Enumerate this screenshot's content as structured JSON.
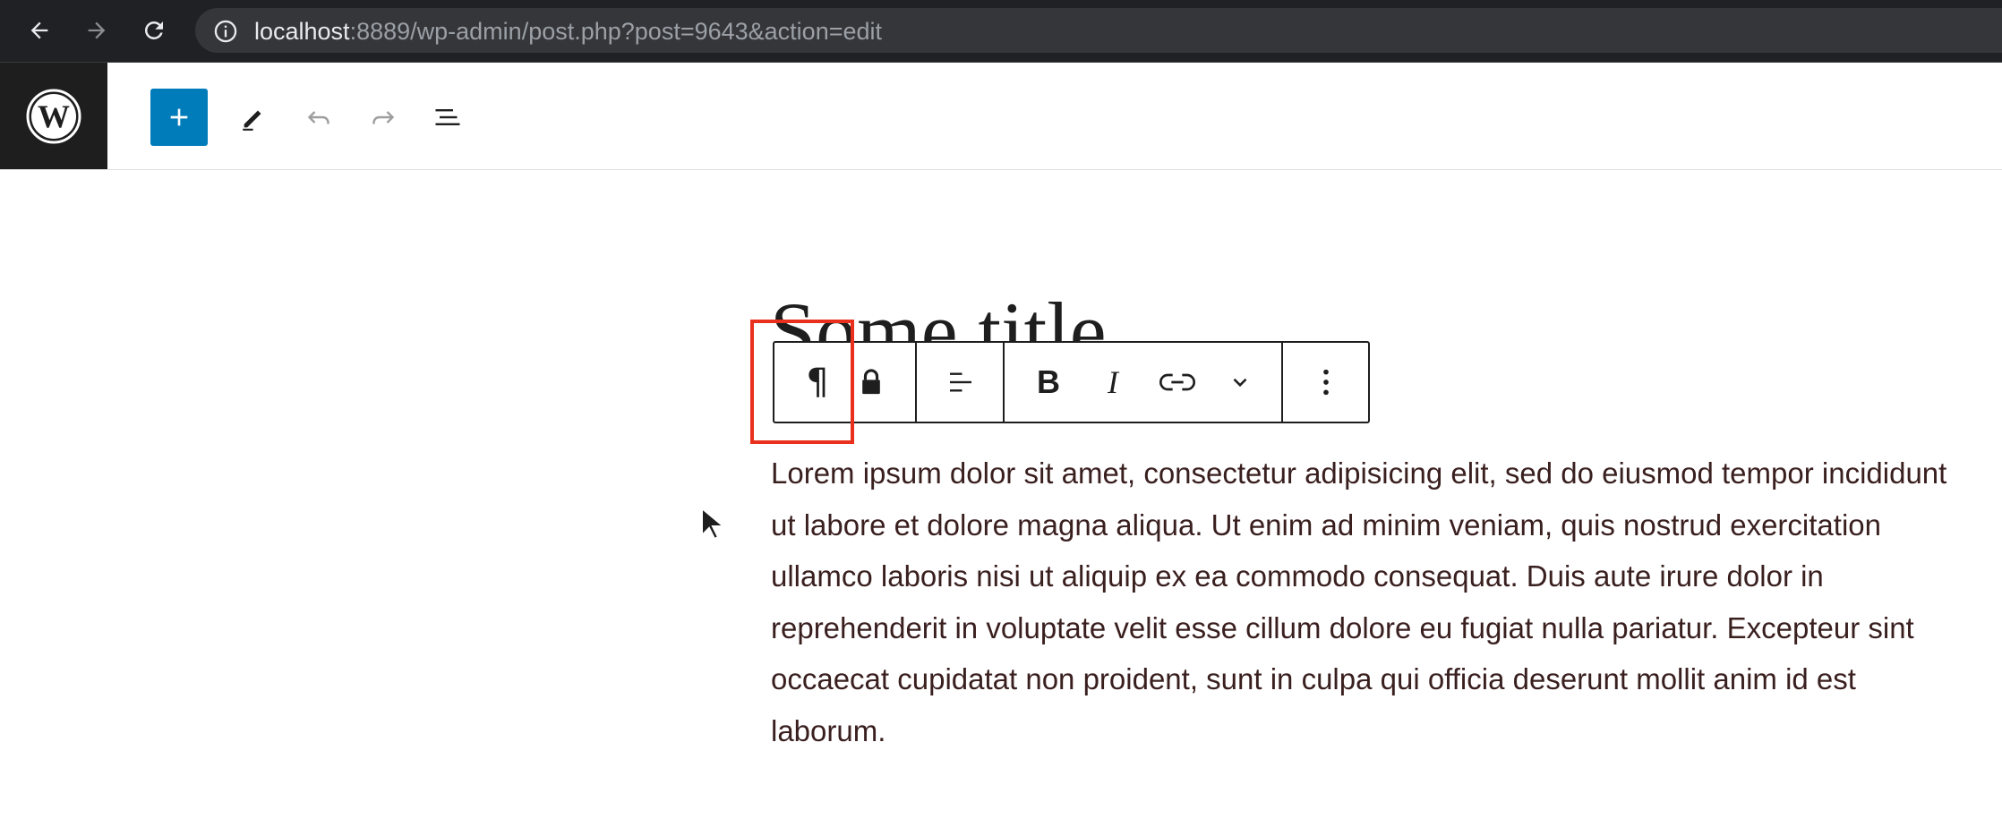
{
  "browser": {
    "url_host": "localhost",
    "url_rest": ":8889/wp-admin/post.php?post=9643&action=edit",
    "icons": [
      "back-arrow-icon",
      "forward-arrow-icon",
      "reload-icon",
      "info-icon"
    ]
  },
  "editor_header": {
    "icons": [
      "wordpress-logo-icon",
      "plus-icon",
      "pencil-icon",
      "undo-icon",
      "redo-icon",
      "list-view-icon"
    ],
    "accent_color": "#007cba"
  },
  "post": {
    "title": "Some title",
    "paragraph": "Lorem ipsum dolor sit amet, consectetur adipisicing elit, sed do eiusmod tempor incididunt ut labore et dolore magna aliqua. Ut enim ad minim veniam, quis nostrud exercitation ullamco laboris nisi ut aliquip ex ea commodo consequat. Duis aute irure dolor in reprehenderit in voluptate velit esse cillum dolore eu fugiat nulla pariatur. Excepteur sint occaecat cupidatat non proident, sunt in culpa qui officia deserunt mollit anim id est laborum."
  },
  "block_toolbar": {
    "paragraph_glyph": "¶",
    "bold_glyph": "B",
    "italic_glyph": "I",
    "icons": [
      "pilcrow-icon",
      "lock-icon",
      "align-left-icon",
      "bold-icon",
      "italic-icon",
      "link-icon",
      "chevron-down-icon",
      "more-vertical-icon"
    ],
    "highlight_color": "#e8301c"
  }
}
